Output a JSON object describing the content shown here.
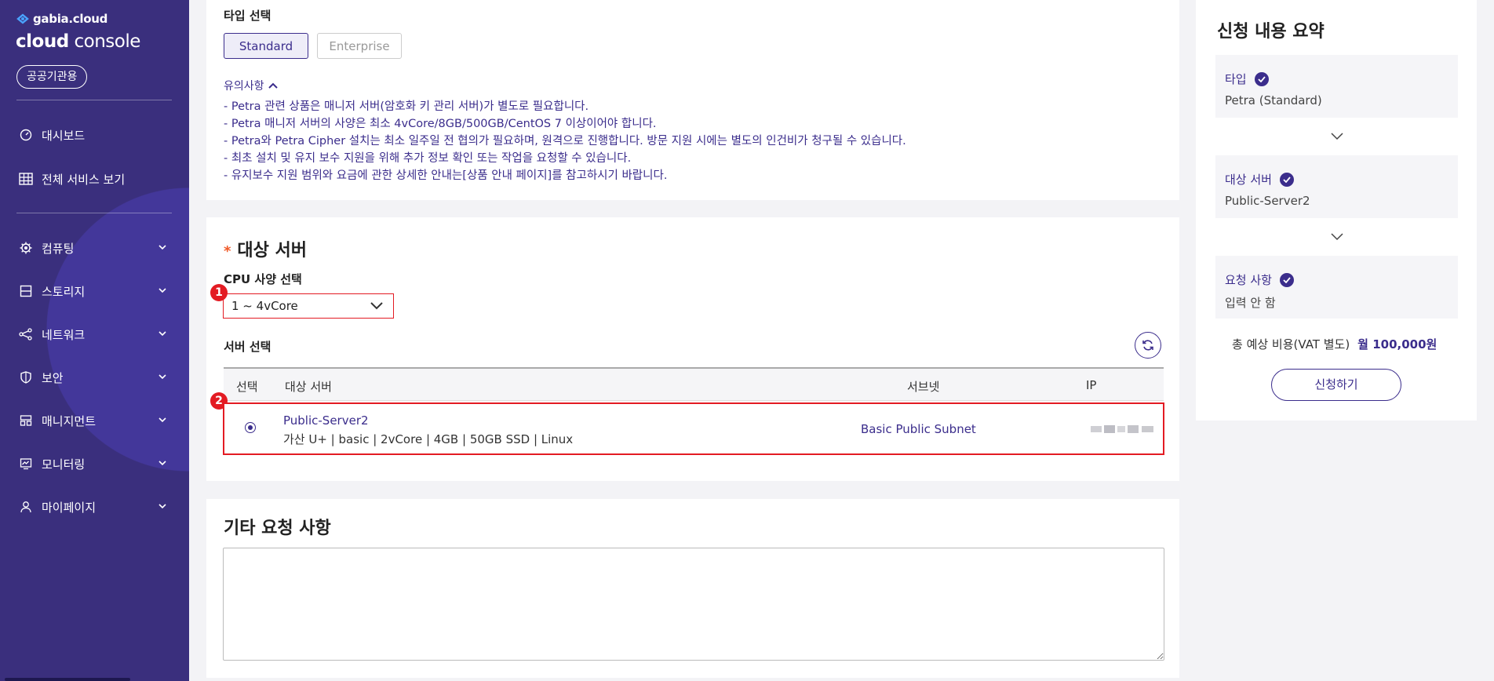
{
  "sidebar": {
    "brand_small": "gabia.cloud",
    "brand_main_bold": "cloud",
    "brand_main_rest": " console",
    "badge": "공공기관용",
    "items": [
      {
        "label": "대시보드",
        "icon": "dashboard-icon",
        "expandable": false
      },
      {
        "label": "전체 서비스 보기",
        "icon": "grid-icon",
        "expandable": false
      },
      {
        "label": "컴퓨팅",
        "icon": "gear-icon",
        "expandable": true
      },
      {
        "label": "스토리지",
        "icon": "storage-icon",
        "expandable": true
      },
      {
        "label": "네트워크",
        "icon": "network-icon",
        "expandable": true
      },
      {
        "label": "보안",
        "icon": "shield-icon",
        "expandable": true
      },
      {
        "label": "매니지먼트",
        "icon": "management-icon",
        "expandable": true
      },
      {
        "label": "모니터링",
        "icon": "monitor-icon",
        "expandable": true
      },
      {
        "label": "마이페이지",
        "icon": "user-icon",
        "expandable": true
      }
    ]
  },
  "type_section": {
    "label": "타입 선택",
    "options": [
      "Standard",
      "Enterprise"
    ],
    "selected": "Standard",
    "notice_toggle": "유의사항",
    "notices": [
      "- Petra 관련 상품은 매니저 서버(암호화 키 관리 서버)가 별도로 필요합니다.",
      "- Petra 매니저 서버의 사양은 최소 4vCore/8GB/500GB/CentOS 7 이상이어야 합니다.",
      "- Petra와 Petra Cipher 설치는 최소 일주일 전 협의가 필요하며, 원격으로 진행합니다. 방문 지원 시에는 별도의 인건비가 청구될 수 있습니다.",
      "- 최초 설치 및 유지 보수 지원을 위해 추가 정보 확인 또는 작업을 요청할 수 있습니다.",
      "- 유지보수 지원 범위와 요금에 관한 상세한 안내는[상품 안내 페이지]를 참고하시기 바랍니다."
    ]
  },
  "target_section": {
    "required_mark": "*",
    "title": "대상 서버",
    "cpu_label": "CPU 사양 선택",
    "cpu_value": "1 ~ 4vCore",
    "server_label": "서버 선택",
    "steps": [
      "1",
      "2"
    ],
    "columns": [
      "선택",
      "대상 서버",
      "서브넷",
      "IP"
    ],
    "rows": [
      {
        "name": "Public-Server2",
        "spec": "가산 U+ | basic | 2vCore | 4GB | 50GB SSD | Linux",
        "subnet": "Basic Public Subnet",
        "selected": true
      }
    ]
  },
  "extra_section": {
    "title": "기타 요청 사항",
    "value": ""
  },
  "summary": {
    "title": "신청 내용 요약",
    "items": [
      {
        "key": "타입",
        "value": "Petra (Standard)"
      },
      {
        "key": "대상 서버",
        "value": "Public-Server2"
      },
      {
        "key": "요청 사항",
        "value": "입력 안 함"
      }
    ],
    "total_label": "총 예상 비용(VAT 별도)",
    "total_value": "월 100,000원",
    "apply": "신청하기"
  },
  "colors": {
    "brand": "#3b2d8c",
    "sidebar": "#3a2f7d",
    "highlight": "#e31b23",
    "required": "#f05a28"
  }
}
